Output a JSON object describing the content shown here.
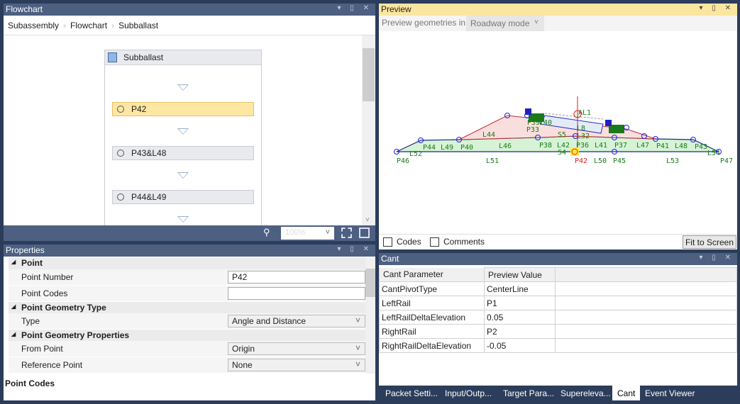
{
  "flowchart": {
    "title": "Flowchart",
    "breadcrumb": [
      "Subassembly",
      "Flowchart",
      "Subballast"
    ],
    "group_title": "Subballast",
    "items": [
      "P42",
      "P43&L48",
      "P44&L49"
    ],
    "selected": "P42",
    "zoom": "100%"
  },
  "properties": {
    "title": "Properties",
    "categories": {
      "point": "Point",
      "geom_type": "Point Geometry Type",
      "geom_props": "Point Geometry Properties"
    },
    "rows": {
      "point_number": {
        "label": "Point Number",
        "value": "P42"
      },
      "point_codes": {
        "label": "Point Codes",
        "value": ""
      },
      "type": {
        "label": "Type",
        "value": "Angle and Distance"
      },
      "from_point": {
        "label": "From Point",
        "value": "Origin"
      },
      "reference_point": {
        "label": "Reference Point",
        "value": "None"
      }
    },
    "description_title": "Point Codes"
  },
  "preview": {
    "title": "Preview",
    "mode_label": "Preview geometries in",
    "mode_value": "Roadway mode",
    "codes_label": "Codes",
    "comments_label": "Comments",
    "fit_label": "Fit to Screen",
    "labels": [
      "P46",
      "L52",
      "P44",
      "L49",
      "P40",
      "L44",
      "L46",
      "P38",
      "L42",
      "S5",
      "S4",
      "P36",
      "L32",
      "L8",
      "AL1",
      "L41",
      "P37",
      "L47",
      "P41",
      "L48",
      "P43",
      "L54",
      "P47",
      "L51",
      "P42",
      "L50",
      "P45",
      "L53",
      "P39",
      "L40",
      "P33"
    ],
    "colors": {
      "subballast_fill": "#d6f3d6",
      "fill_red": "#f9dede",
      "ballast_fill": "#e3ebf7",
      "point": "#2020e0",
      "label": "#1a7a1a",
      "selected": "#e02020",
      "highlight": "#ffee40"
    }
  },
  "cant": {
    "title": "Cant",
    "headers": [
      "Cant Parameter",
      "Preview Value"
    ],
    "rows": [
      [
        "CantPivotType",
        "CenterLine"
      ],
      [
        "LeftRail",
        "P1"
      ],
      [
        "LeftRailDeltaElevation",
        "0.05"
      ],
      [
        "RightRail",
        "P2"
      ],
      [
        "RightRailDeltaElevation",
        "-0.05"
      ]
    ]
  },
  "tabs": [
    "Packet Setti...",
    "Input/Outp...",
    "Target Para...",
    "Supereleva...",
    "Cant",
    "Event Viewer"
  ],
  "selected_tab": "Cant"
}
